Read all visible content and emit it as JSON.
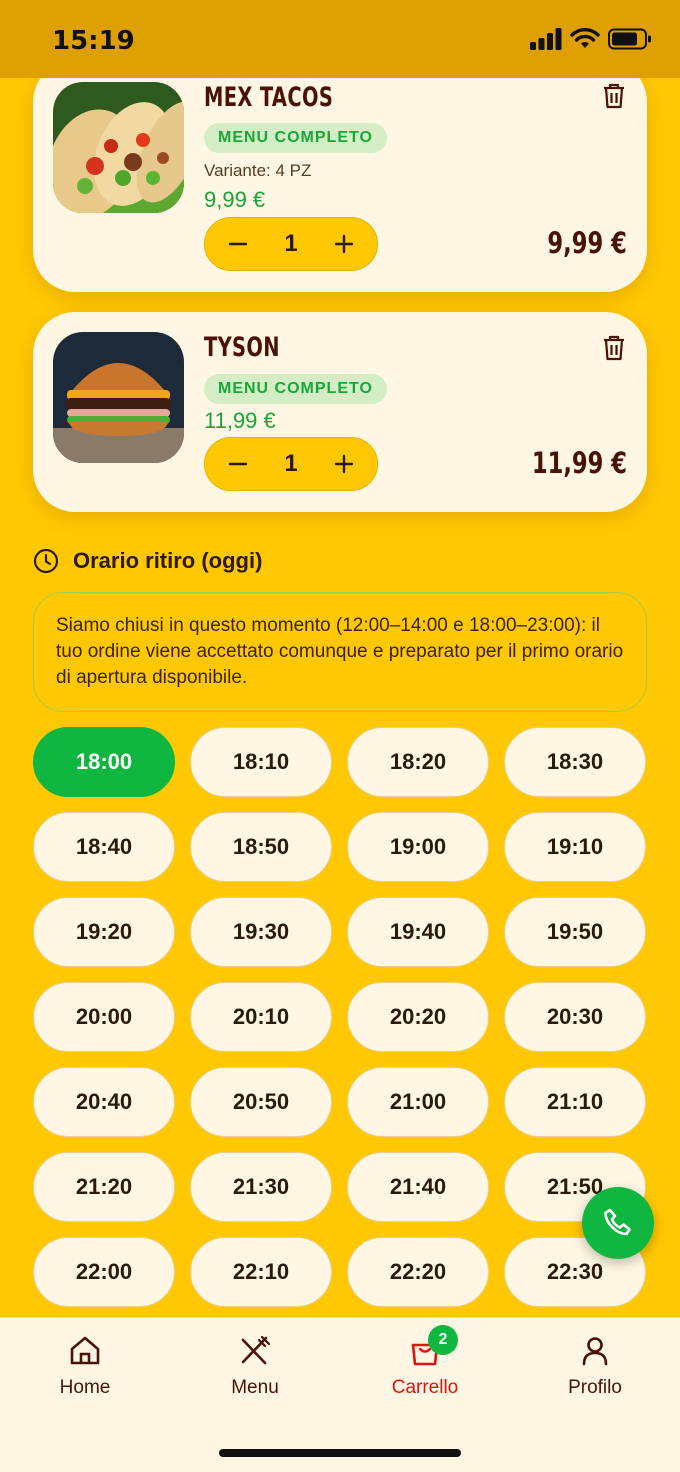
{
  "status_bar": {
    "time": "15:19"
  },
  "cart": {
    "items": [
      {
        "name": "MEX TACOS",
        "badge": "MENU COMPLETO",
        "variant": "Variante: 4 PZ",
        "unit_price": "9,99 €",
        "quantity": "1",
        "line_total": "9,99 €",
        "image": "tacos-photo"
      },
      {
        "name": "TYSON",
        "badge": "MENU COMPLETO",
        "unit_price": "11,99 €",
        "quantity": "1",
        "line_total": "11,99 €",
        "image": "burger-photo"
      }
    ]
  },
  "pickup": {
    "title": "Orario ritiro (oggi)",
    "notice": "Siamo chiusi in questo momento (12:00–14:00 e 18:00–23:00): il tuo ordine viene accettato comunque e preparato per il primo orario di apertura disponibile.",
    "selected_slot": "18:00",
    "slots": [
      "18:00",
      "18:10",
      "18:20",
      "18:30",
      "18:40",
      "18:50",
      "19:00",
      "19:10",
      "19:20",
      "19:30",
      "19:40",
      "19:50",
      "20:00",
      "20:10",
      "20:20",
      "20:30",
      "20:40",
      "20:50",
      "21:00",
      "21:10",
      "21:20",
      "21:30",
      "21:40",
      "21:50",
      "22:00",
      "22:10",
      "22:20",
      "22:30"
    ]
  },
  "nav": {
    "items": [
      {
        "label": "Home",
        "icon": "home-icon"
      },
      {
        "label": "Menu",
        "icon": "cutlery-icon"
      },
      {
        "label": "Carrello",
        "icon": "cart-icon",
        "badge": "2",
        "active": true
      },
      {
        "label": "Profilo",
        "icon": "user-icon"
      }
    ]
  },
  "colors": {
    "background": "#FFC803",
    "accent_green": "#0FB63F",
    "active_red": "#E2120E",
    "title_brown": "#4A1206"
  }
}
